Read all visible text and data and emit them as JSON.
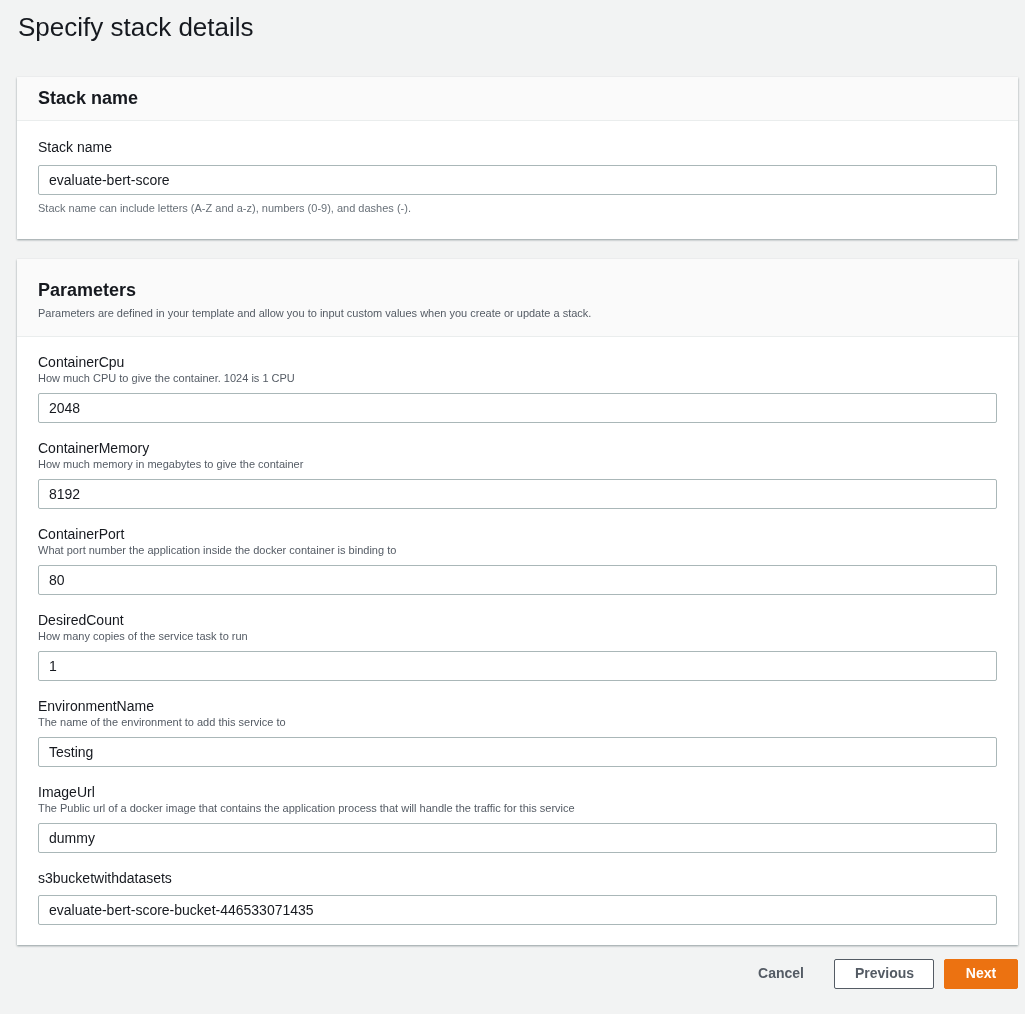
{
  "title": "Specify stack details",
  "stack_section": {
    "heading": "Stack name",
    "field": {
      "label": "Stack name",
      "value": "evaluate-bert-score",
      "hint": "Stack name can include letters (A-Z and a-z), numbers (0-9), and dashes (-)."
    }
  },
  "parameters_section": {
    "heading": "Parameters",
    "description": "Parameters are defined in your template and allow you to input custom values when you create or update a stack.",
    "fields": [
      {
        "label": "ContainerCpu",
        "description": "How much CPU to give the container. 1024 is 1 CPU",
        "value": "2048"
      },
      {
        "label": "ContainerMemory",
        "description": "How much memory in megabytes to give the container",
        "value": "8192"
      },
      {
        "label": "ContainerPort",
        "description": "What port number the application inside the docker container is binding to",
        "value": "80"
      },
      {
        "label": "DesiredCount",
        "description": "How many copies of the service task to run",
        "value": "1"
      },
      {
        "label": "EnvironmentName",
        "description": "The name of the environment to add this service to",
        "value": "Testing"
      },
      {
        "label": "ImageUrl",
        "description": "The Public url of a docker image that contains the application process that will handle the traffic for this service",
        "value": "dummy"
      },
      {
        "label": "s3bucketwithdatasets",
        "value": "evaluate-bert-score-bucket-446533071435"
      }
    ]
  },
  "buttons": [
    {
      "label": "Cancel",
      "kind": "link"
    },
    {
      "label": "Previous",
      "kind": "normal"
    },
    {
      "label": "Next",
      "kind": "primary"
    }
  ]
}
